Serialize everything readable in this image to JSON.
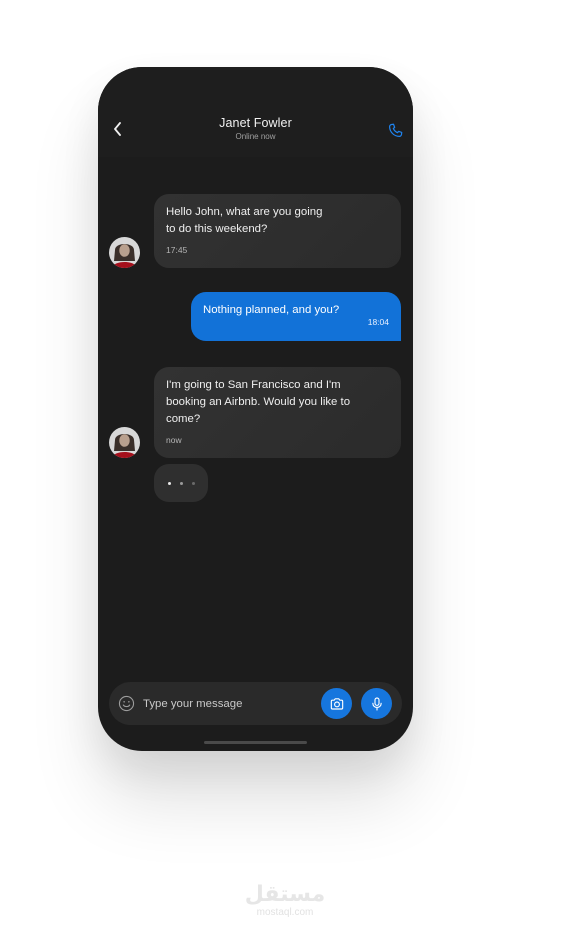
{
  "header": {
    "contact_name": "Janet Fowler",
    "status": "Online now",
    "back_icon": "chevron-left-icon",
    "call_icon": "phone-icon"
  },
  "messages": [
    {
      "direction": "incoming",
      "text": "Hello John, what are you going\nto do this weekend?",
      "time": "17:45"
    },
    {
      "direction": "outgoing",
      "text": "Nothing planned, and you?",
      "time": "18:04"
    },
    {
      "direction": "incoming",
      "text": "I'm going to San Francisco and I'm\nbooking an Airbnb. Would you like to\ncome?",
      "time": "now"
    }
  ],
  "typing_indicator": {
    "visible": true
  },
  "composer": {
    "placeholder": "Type your message",
    "emoji_icon": "smiley-icon",
    "camera_icon": "camera-icon",
    "mic_icon": "microphone-icon"
  },
  "colors": {
    "background": "#1c1c1c",
    "accent": "#1676de",
    "outgoing_bubble": "#1272d8",
    "incoming_bubble": "#303030"
  },
  "watermark": {
    "arabic": "مستقل",
    "latin": "mostaql.com"
  }
}
